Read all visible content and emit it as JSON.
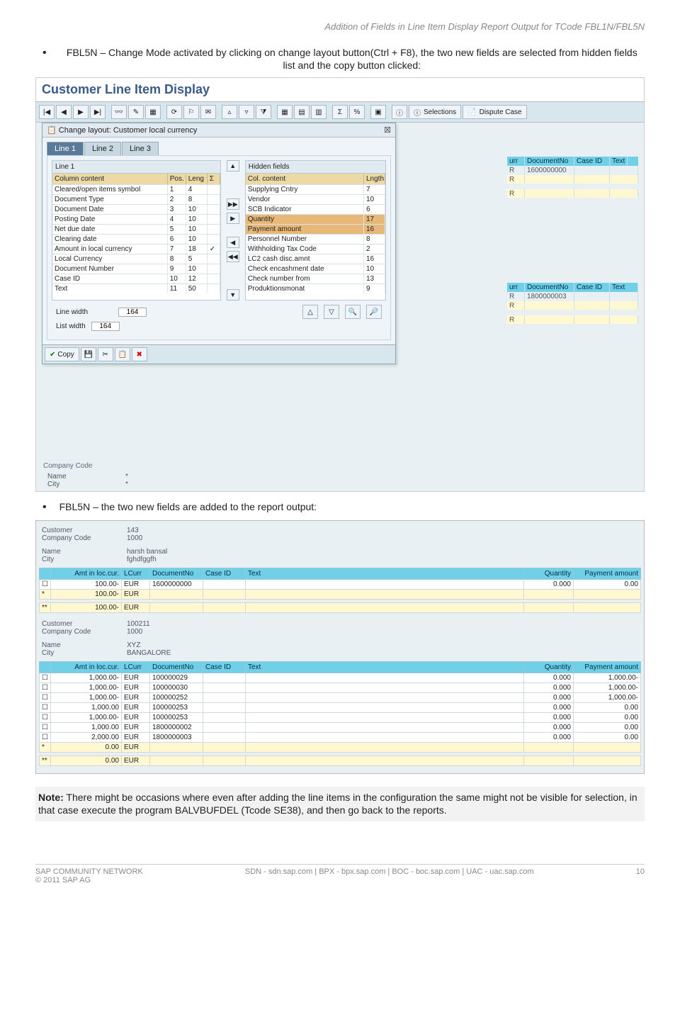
{
  "doc_header": "Addition of Fields in Line Item Display Report Output for TCode FBL1N/FBL5N",
  "bullet1": "FBL5N – Change Mode activated by clicking on change layout button(Ctrl + F8), the two new fields are selected from hidden fields list and the copy button clicked:",
  "sap_title": "Customer Line Item Display",
  "popup_title": "Change layout: Customer local currency",
  "tabs": [
    "Line 1",
    "Line 2",
    "Line 3"
  ],
  "line1_label": "Line 1",
  "col_head": {
    "cc": "Column content",
    "pos": "Pos.",
    "len": "Leng",
    "sum": "Σ"
  },
  "line1_rows": [
    [
      "Cleared/open items symbol",
      "1",
      "4",
      ""
    ],
    [
      "Document Type",
      "2",
      "8",
      ""
    ],
    [
      "Document Date",
      "3",
      "10",
      ""
    ],
    [
      "Posting Date",
      "4",
      "10",
      ""
    ],
    [
      "Net due date",
      "5",
      "10",
      ""
    ],
    [
      "Clearing date",
      "6",
      "10",
      ""
    ],
    [
      "Amount in local currency",
      "7",
      "18",
      "✓"
    ],
    [
      "Local Currency",
      "8",
      "5",
      ""
    ],
    [
      "Document Number",
      "9",
      "10",
      ""
    ],
    [
      "Case ID",
      "10",
      "12",
      ""
    ],
    [
      "Text",
      "11",
      "50",
      ""
    ]
  ],
  "hidden_label": "Hidden fields",
  "hidden_head": {
    "cc": "Col. content",
    "len": "Lngth"
  },
  "hidden_rows": [
    [
      "Supplying Cntry",
      "7",
      false
    ],
    [
      "Vendor",
      "10",
      false
    ],
    [
      "SCB Indicator",
      "6",
      false
    ],
    [
      "Quantity",
      "17",
      true
    ],
    [
      "Payment amount",
      "16",
      true
    ],
    [
      "Personnel Number",
      "8",
      false
    ],
    [
      "Withholding Tax Code",
      "2",
      false
    ],
    [
      "LC2 cash disc.amnt",
      "16",
      false
    ],
    [
      "Check encashment date",
      "10",
      false
    ],
    [
      "Check number from",
      "13",
      false
    ],
    [
      "Produktionsmonat",
      "9",
      false
    ]
  ],
  "line_width_label": "Line width",
  "line_width_val": "164",
  "list_width_label": "List width",
  "list_width_val": "164",
  "copy_label": "Copy",
  "bg_cols": [
    "urr",
    "DocumentNo",
    "Case ID",
    "Text"
  ],
  "bg_doc1": "1600000000",
  "bg_doc2": "1800000003",
  "name_label": "Name",
  "city_label": "City",
  "star": "*",
  "selections_label": "Selections",
  "dispute_label": "Dispute Case",
  "company_code_label": "Company Code",
  "bullet2": "FBL5N – the two new fields are added to the report output:",
  "cust1": {
    "customer": "143",
    "cc": "1000",
    "name": "harsh bansal",
    "city": "fghdfggfh"
  },
  "rep_cols": [
    "Amt in loc.cur.",
    "LCurr",
    "DocumentNo",
    "Case ID",
    "Text",
    "Quantity",
    "Payment amount"
  ],
  "rep1_rows": [
    {
      "amt": "100.00-",
      "lc": "EUR",
      "doc": "1600000000",
      "qty": "0.000",
      "pay": "0.00",
      "chk": true
    },
    {
      "amt": "100.00-",
      "lc": "EUR",
      "doc": "",
      "qty": "",
      "pay": "",
      "star": "*"
    }
  ],
  "rep1_sum": {
    "amt": "100.00-",
    "lc": "EUR",
    "star": "**"
  },
  "cust2": {
    "customer": "100211",
    "cc": "1000",
    "name": "XYZ",
    "city": "BANGALORE"
  },
  "rep2_rows": [
    {
      "amt": "1,000.00-",
      "lc": "EUR",
      "doc": "100000029",
      "qty": "0.000",
      "pay": "1,000.00-"
    },
    {
      "amt": "1,000.00-",
      "lc": "EUR",
      "doc": "100000030",
      "qty": "0.000",
      "pay": "1,000.00-"
    },
    {
      "amt": "1,000.00-",
      "lc": "EUR",
      "doc": "100000252",
      "qty": "0.000",
      "pay": "1,000.00-"
    },
    {
      "amt": "1,000.00",
      "lc": "EUR",
      "doc": "100000253",
      "qty": "0.000",
      "pay": "0.00"
    },
    {
      "amt": "1,000.00-",
      "lc": "EUR",
      "doc": "100000253",
      "qty": "0.000",
      "pay": "0.00"
    },
    {
      "amt": "1,000.00",
      "lc": "EUR",
      "doc": "1800000002",
      "qty": "0.000",
      "pay": "0.00"
    },
    {
      "amt": "2,000.00",
      "lc": "EUR",
      "doc": "1800000003",
      "qty": "0.000",
      "pay": "0.00"
    }
  ],
  "rep2_sub": {
    "amt": "0.00",
    "lc": "EUR",
    "star": "*"
  },
  "rep2_sum": {
    "amt": "0.00",
    "lc": "EUR",
    "star": "**"
  },
  "customer_label": "Customer",
  "cc_label": "Company Code",
  "note_bold": "Note:",
  "note_text": " There might be occasions where even after adding the line items in the configuration the same might not be visible for selection, in that case execute the program BALVBUFDEL (Tcode SE38), and then go back to the reports.",
  "footer_left": "SAP COMMUNITY NETWORK",
  "footer_mid": "SDN - sdn.sap.com  |  BPX - bpx.sap.com  |  BOC - boc.sap.com  |  UAC - uac.sap.com",
  "footer_copy": "© 2011 SAP AG",
  "footer_page": "10"
}
